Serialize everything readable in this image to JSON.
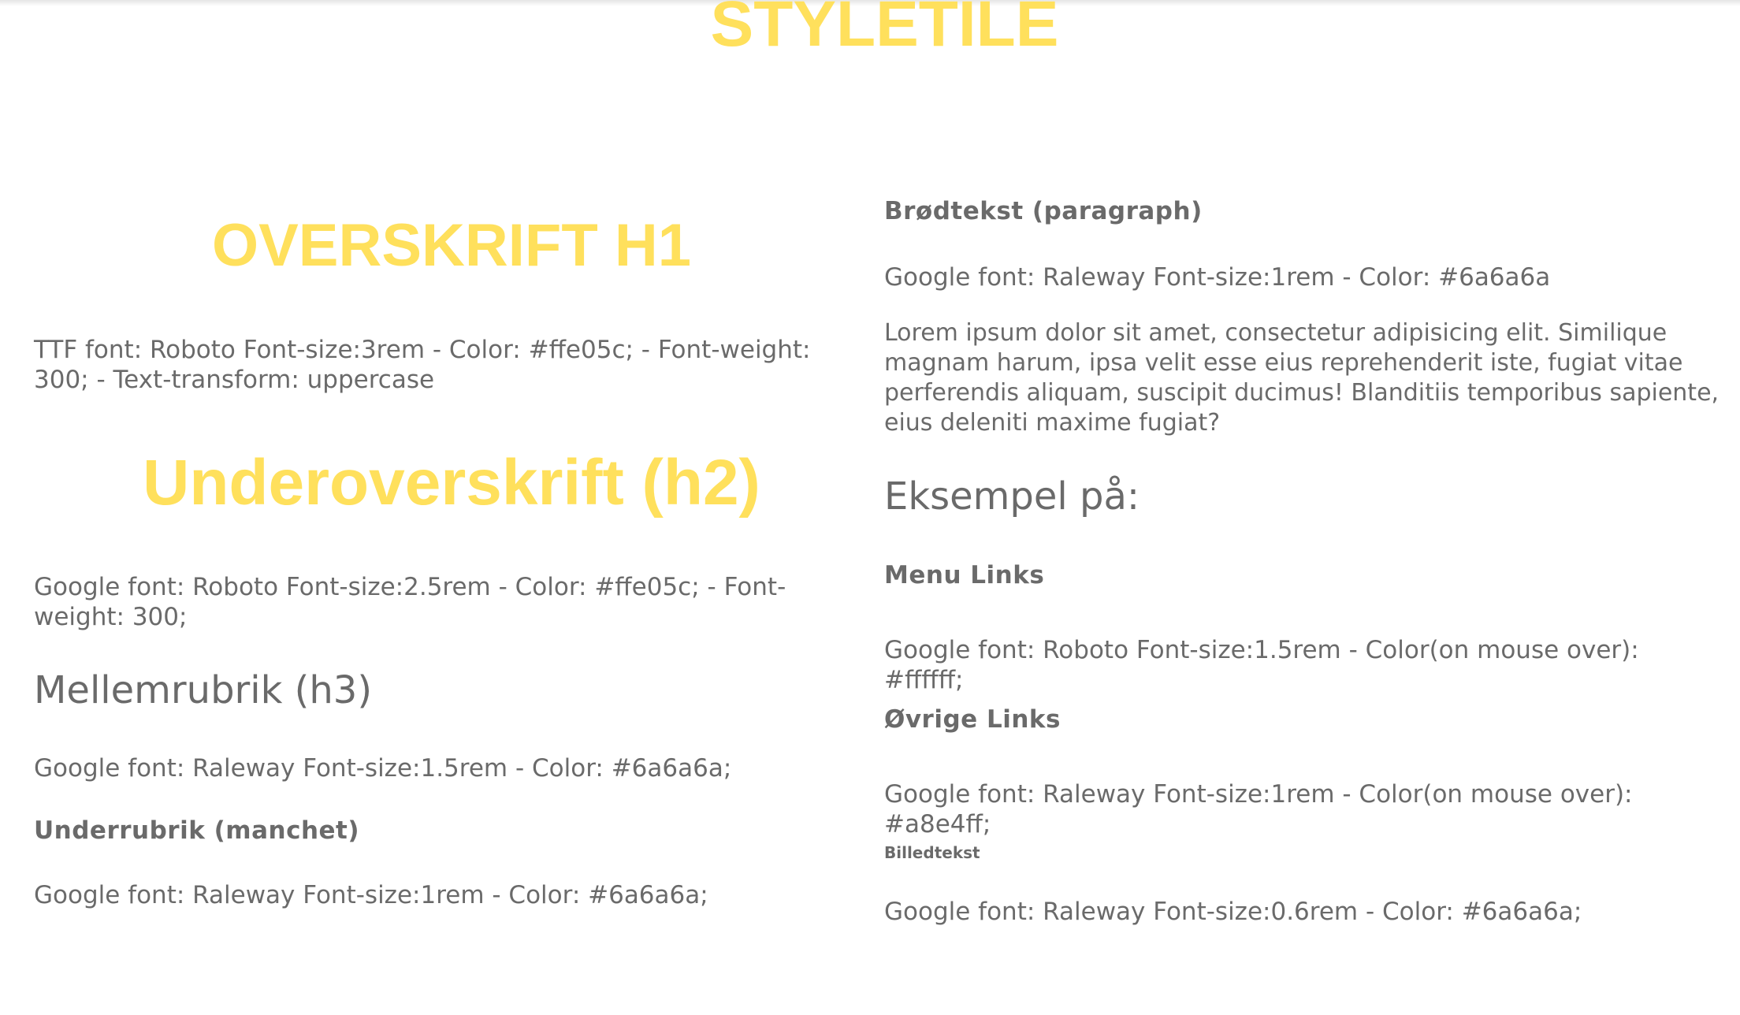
{
  "title": "STYLETILE",
  "left": {
    "h1_sample": "OVERSKRIFT H1",
    "h1_desc": "TTF font: Roboto Font-size:3rem - Color: #ffe05c; - Font-weight: 300; - Text-transform: uppercase",
    "h2_sample": "Underoverskrift (h2)",
    "h2_desc": "Google font: Roboto Font-size:2.5rem - Color: #ffe05c; - Font-weight: 300;",
    "h3_sample": "Mellemrubrik (h3)",
    "h3_desc": "Google font: Raleway Font-size:1.5rem - Color: #6a6a6a;",
    "h4_sample": "Underrubrik (manchet)",
    "h4_desc": "Google font: Raleway Font-size:1rem - Color: #6a6a6a;"
  },
  "right": {
    "paragraph_heading": "Brødtekst (paragraph)",
    "paragraph_desc": "Google font: Raleway Font-size:1rem - Color: #6a6a6a",
    "lorem": "Lorem ipsum dolor sit amet, consectetur adipisicing elit. Similique magnam harum, ipsa velit esse eius reprehenderit iste, fugiat vitae perferendis aliquam, suscipit ducimus! Blanditiis temporibus sapiente, eius deleniti maxime fugiat?",
    "example_heading": "Eksempel på:",
    "menu_links_heading": "Menu Links",
    "menu_links_desc": "Google font: Roboto Font-size:1.5rem - Color(on mouse over): #ffffff;",
    "other_links_heading": "Øvrige Links",
    "other_links_desc": "Google font: Raleway Font-size:1rem - Color(on mouse over): #a8e4ff;",
    "caption_heading": "Billedtekst",
    "caption_desc": "Google font: Raleway Font-size:0.6rem - Color: #6a6a6a;"
  },
  "colors": {
    "accent": "#ffe05c",
    "text": "#6a6a6a",
    "background": "#ffffff"
  }
}
